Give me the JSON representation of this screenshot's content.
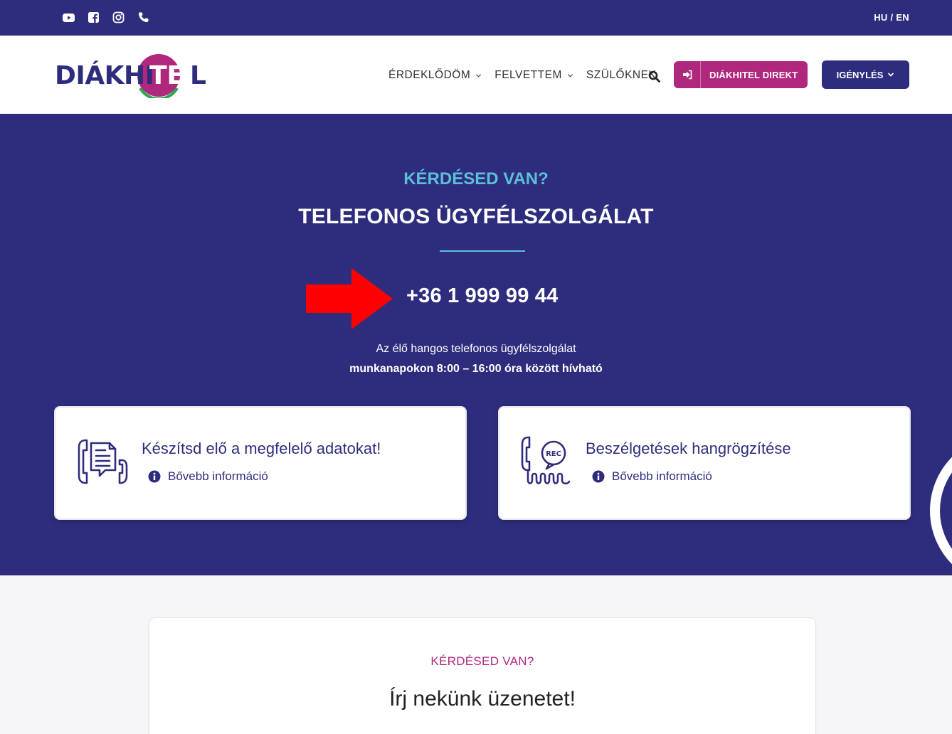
{
  "topbar": {
    "social_icons": [
      "youtube-icon",
      "facebook-icon",
      "instagram-icon",
      "phone-icon"
    ],
    "lang": "HU / EN"
  },
  "header": {
    "logo_text": "DIÁKHITEL",
    "nav": [
      {
        "label": "ÉRDEKLŐDÖM",
        "has_dropdown": true
      },
      {
        "label": "FELVETTEM",
        "has_dropdown": true
      },
      {
        "label": "SZÜLŐKNEK",
        "has_dropdown": false
      }
    ],
    "direkt_label": "DIÁKHITEL DIREKT",
    "igenyles_label": "IGÉNYLÉS"
  },
  "hero": {
    "eyebrow": "KÉRDÉSED VAN?",
    "title": "TELEFONOS ÜGYFÉLSZOLGÁLAT",
    "phone": "+36 1 999 99 44",
    "info_line1": "Az élő hangos telefonos ügyfélszolgálat",
    "info_line2": "munkanapokon 8:00 – 16:00 óra között hívható",
    "cards": [
      {
        "title": "Készítsd elő a megfelelő adatokat!",
        "more": "Bővebb információ",
        "icon": "phone-document-icon"
      },
      {
        "title": "Beszélgetések hangrögzítése",
        "more": "Bővebb információ",
        "icon": "phone-rec-icon",
        "icon_text": "REC"
      }
    ]
  },
  "contact": {
    "eyebrow": "KÉRDÉSED VAN?",
    "title": "Írj nekünk üzenetet!"
  },
  "colors": {
    "navy": "#2e2d7d",
    "magenta": "#b0287e",
    "cyan": "#5bbfd5",
    "arrow_red": "#ff0000"
  }
}
